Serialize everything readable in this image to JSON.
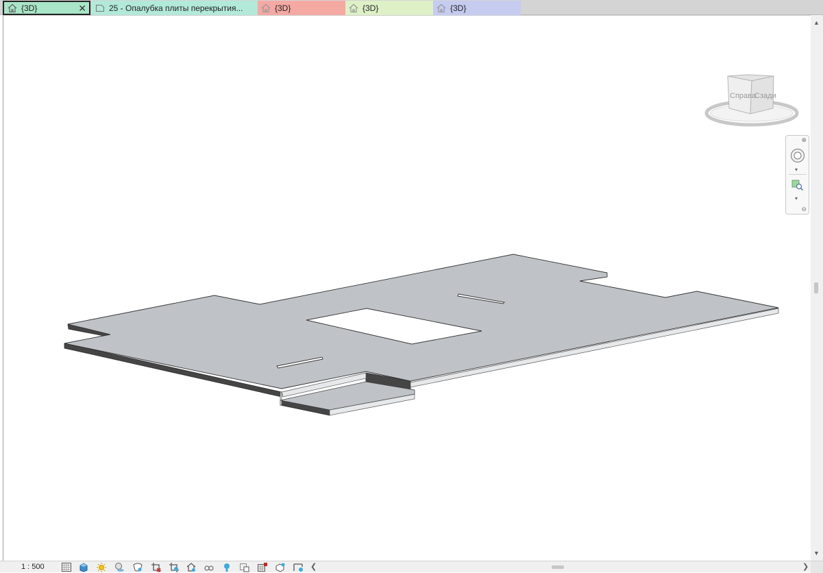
{
  "tabs": [
    {
      "label": "{3D}",
      "icon": "home-3d-icon",
      "color": "#a9e5c8",
      "active": true,
      "close": "✕"
    },
    {
      "label": "25 - Опалубка плиты перекрытия...",
      "icon": "sheet-view-icon",
      "color": "#b3e9d9",
      "active": false
    },
    {
      "label": "{3D}",
      "icon": "home-3d-icon",
      "color": "#f4a9a3",
      "active": false
    },
    {
      "label": "{3D}",
      "icon": "home-3d-icon",
      "color": "#def0c6",
      "active": false
    },
    {
      "label": "{3D}",
      "icon": "home-3d-icon",
      "color": "#c6cbf0",
      "active": false
    }
  ],
  "viewcube": {
    "face_right": "Справа",
    "face_back": "Сзади"
  },
  "statusbar": {
    "scale": "1 : 500",
    "icons": [
      "detail-level-icon",
      "visual-style-icon",
      "sun-path-icon",
      "shadows-icon",
      "render-dialog-icon",
      "crop-view-icon",
      "show-crop-region-icon",
      "unlock-3d-view-icon",
      "temporary-hide-icon",
      "reveal-hidden-icon",
      "worksharing-display-icon",
      "temporary-view-properties-icon",
      "analytical-model-icon",
      "highlight-displacement-icon",
      "show-constraints-icon"
    ]
  },
  "colors": {
    "slab_top": "#bfc3c7",
    "slab_edge": "#444444",
    "slab_light_edge": "#e6e8ea"
  }
}
